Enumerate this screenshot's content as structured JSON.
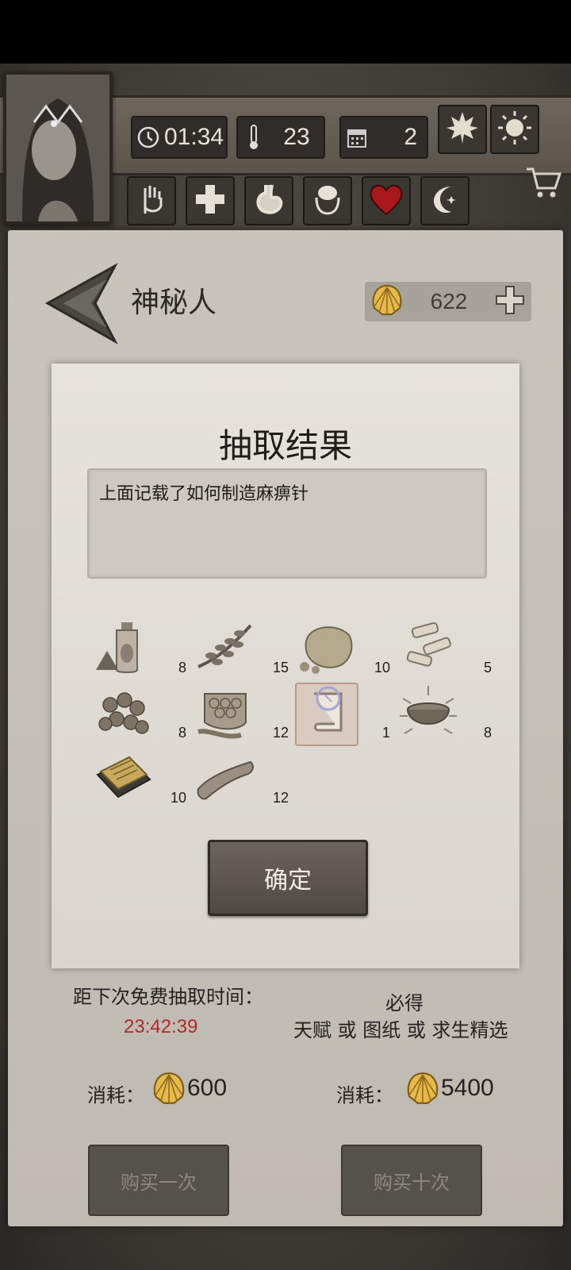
{
  "hud": {
    "time": "01:34",
    "temperature": "23",
    "day": "2",
    "icons": [
      "clock-icon",
      "thermometer-icon",
      "calendar-icon",
      "maple-leaf-icon",
      "sun-icon",
      "shop-cart-icon"
    ],
    "status_icons": [
      "hand-icon",
      "health-cross-icon",
      "stomach-icon",
      "brain-icon",
      "heart-icon",
      "moon-icon"
    ]
  },
  "header": {
    "title": "神秘人",
    "currency": "622"
  },
  "modal": {
    "title": "抽取结果",
    "description": "上面记载了如何制造麻痹针",
    "confirm_label": "确定",
    "items": [
      {
        "icon": "oil-bottle-icon",
        "count": "8"
      },
      {
        "icon": "herb-branch-icon",
        "count": "15"
      },
      {
        "icon": "stone-icon",
        "count": "10"
      },
      {
        "icon": "bone-pieces-icon",
        "count": "5"
      },
      {
        "icon": "berries-icon",
        "count": "8"
      },
      {
        "icon": "honeycomb-icon",
        "count": "12"
      },
      {
        "icon": "scroll-blueprint-icon",
        "count": "1"
      },
      {
        "icon": "bowl-icon",
        "count": "8"
      },
      {
        "icon": "book-icon",
        "count": "10"
      },
      {
        "icon": "meat-strip-icon",
        "count": "12"
      }
    ]
  },
  "draw": {
    "free_label": "距下次免费抽取时间：",
    "timer": "23:42:39",
    "guarantee_line1": "必得",
    "guarantee_line2": "天赋 或 图纸 或 求生精选",
    "cost_label": "消耗：",
    "cost_single": "600",
    "cost_ten": "5400",
    "buy_once": "购买一次",
    "buy_ten": "购买十次"
  },
  "colors": {
    "timer": "#b02a2a",
    "heart": "#a8181a"
  }
}
